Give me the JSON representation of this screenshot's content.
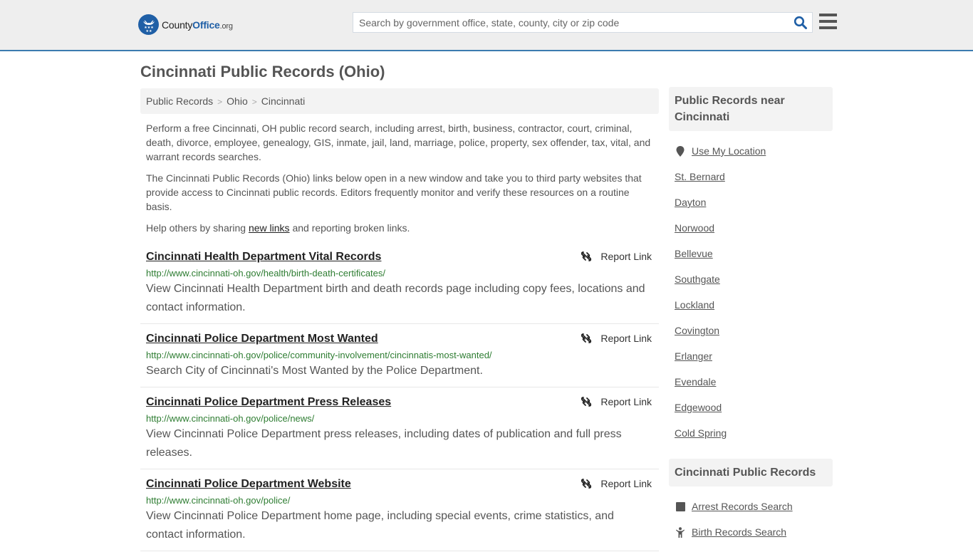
{
  "header": {
    "logo": {
      "county": "County",
      "office": "Office",
      "org": ".org"
    },
    "search_placeholder": "Search by government office, state, county, city or zip code",
    "search_value": ""
  },
  "page_title": "Cincinnati Public Records (Ohio)",
  "breadcrumb": [
    "Public Records",
    "Ohio",
    "Cincinnati"
  ],
  "intro": {
    "p1": "Perform a free Cincinnati, OH public record search, including arrest, birth, business, contractor, court, criminal, death, divorce, employee, genealogy, GIS, inmate, jail, land, marriage, police, property, sex offender, tax, vital, and warrant records searches.",
    "p2": "The Cincinnati Public Records (Ohio) links below open in a new window and take you to third party websites that provide access to Cincinnati public records. Editors frequently monitor and verify these resources on a routine basis.",
    "p3_before": "Help others by sharing ",
    "p3_link": "new links",
    "p3_after": " and reporting broken links."
  },
  "report_label": "Report Link",
  "records": [
    {
      "title": "Cincinnati Health Department Vital Records",
      "url": "http://www.cincinnati-oh.gov/health/birth-death-certificates/",
      "desc": "View Cincinnati Health Department birth and death records page including copy fees, locations and contact information."
    },
    {
      "title": "Cincinnati Police Department Most Wanted",
      "url": "http://www.cincinnati-oh.gov/police/community-involvement/cincinnatis-most-wanted/",
      "desc": "Search City of Cincinnati's Most Wanted by the Police Department."
    },
    {
      "title": "Cincinnati Police Department Press Releases",
      "url": "http://www.cincinnati-oh.gov/police/news/",
      "desc": "View Cincinnati Police Department press releases, including dates of publication and full press releases."
    },
    {
      "title": "Cincinnati Police Department Website",
      "url": "http://www.cincinnati-oh.gov/police/",
      "desc": "View Cincinnati Police Department home page, including special events, crime statistics, and contact information."
    }
  ],
  "sidebar": {
    "near_title": "Public Records near Cincinnati",
    "use_location": "Use My Location",
    "nearby": [
      "St. Bernard",
      "Dayton",
      "Norwood",
      "Bellevue",
      "Southgate",
      "Lockland",
      "Covington",
      "Erlanger",
      "Evendale",
      "Edgewood",
      "Cold Spring"
    ],
    "records_title": "Cincinnati Public Records",
    "record_links": [
      {
        "label": "Arrest Records Search",
        "icon": "square-icon"
      },
      {
        "label": "Birth Records Search",
        "icon": "child-icon"
      }
    ]
  },
  "colors": {
    "brand_blue": "#1f5fa6",
    "header_border": "#3b7bb0",
    "url_green": "#2e7d32"
  }
}
